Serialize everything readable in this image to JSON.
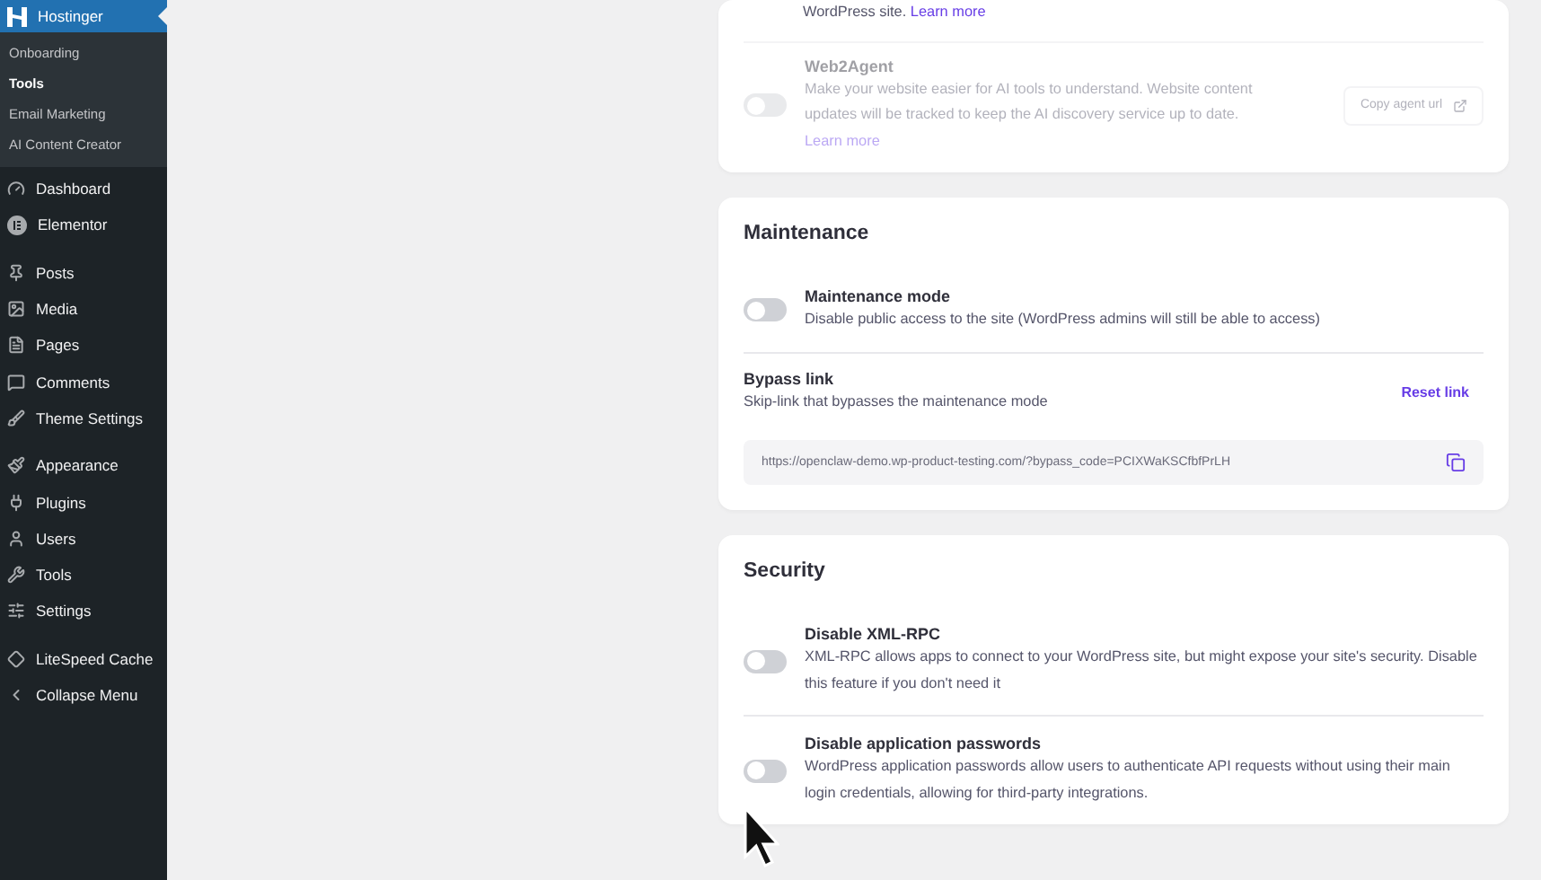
{
  "sidebar": {
    "hostinger": {
      "label": "Hostinger",
      "selected": true,
      "children": [
        {
          "label": "Onboarding",
          "selected": false
        },
        {
          "label": "Tools",
          "selected": true
        },
        {
          "label": "Email Marketing",
          "selected": false
        },
        {
          "label": "AI Content Creator",
          "selected": false
        }
      ]
    },
    "groups": [
      {
        "items": [
          {
            "label": "Dashboard",
            "selected": false
          },
          {
            "label": "Elementor",
            "selected": false
          }
        ]
      },
      {
        "items": [
          {
            "label": "Posts",
            "selected": false
          },
          {
            "label": "Media",
            "selected": false
          },
          {
            "label": "Pages",
            "selected": false
          },
          {
            "label": "Comments",
            "selected": false
          },
          {
            "label": "Theme Settings",
            "selected": false
          }
        ]
      },
      {
        "items": [
          {
            "label": "Appearance",
            "selected": false
          },
          {
            "label": "Plugins",
            "selected": false
          },
          {
            "label": "Users",
            "selected": false
          },
          {
            "label": "Tools",
            "selected": false
          },
          {
            "label": "Settings",
            "selected": false
          }
        ]
      },
      {
        "items": [
          {
            "label": "LiteSpeed Cache",
            "selected": false
          },
          {
            "label": "Collapse Menu",
            "selected": false
          }
        ]
      }
    ]
  },
  "cards": [
    {
      "settings": [
        {
          "kind": "tail",
          "description": "WordPress site.",
          "link": "Learn more"
        },
        {
          "kind": "action",
          "title": "Web2Agent",
          "disabled": true,
          "on": false,
          "description": "Make your website easier for AI tools to understand. Website content updates will be tracked to keep the AI discovery service up to date.",
          "link": "Learn more",
          "button": "Copy agent url"
        }
      ]
    },
    {
      "title": "Maintenance",
      "settings": [
        {
          "kind": "toggle",
          "title": "Maintenance mode",
          "on": false,
          "disabled": false,
          "description": "Disable public access to the site (WordPress admins will still be able to access)"
        },
        {
          "kind": "link",
          "title": "Bypass link",
          "description": "Skip-link that bypasses the maintenance mode",
          "action": "Reset link",
          "url": "https://openclaw-demo.wp-product-testing.com/?bypass_code=PCIXWaKSCfbfPrLH"
        }
      ]
    },
    {
      "title": "Security",
      "settings": [
        {
          "kind": "toggle",
          "title": "Disable XML-RPC",
          "on": false,
          "disabled": false,
          "description": "XML-RPC allows apps to connect to your WordPress site, but might expose your site's security. Disable this feature if you don't need it"
        },
        {
          "kind": "toggle",
          "title": "Disable application passwords",
          "on": false,
          "disabled": false,
          "description": "WordPress application passwords allow users to authenticate API requests without using their main login credentials, allowing for third-party integrations."
        }
      ]
    }
  ]
}
